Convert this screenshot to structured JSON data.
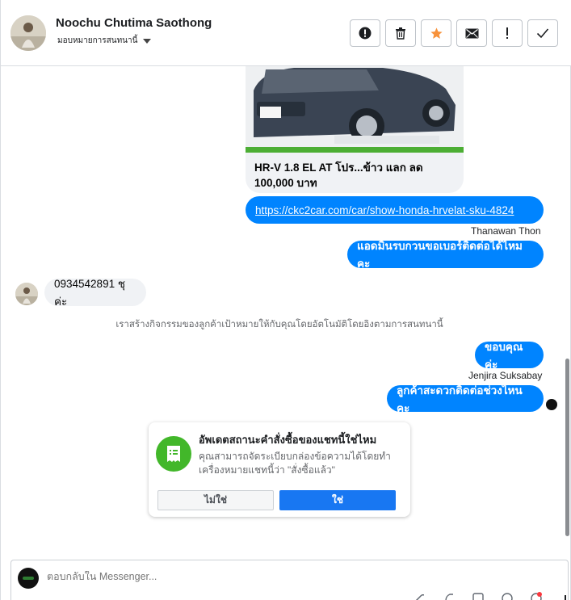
{
  "header": {
    "contact_name": "Noochu Chutima Saothong",
    "assign_label": "มอบหมายการสนทนานี้",
    "actions": [
      {
        "name": "spam-button",
        "icon": "alert-circle-icon"
      },
      {
        "name": "delete-button",
        "icon": "trash-icon"
      },
      {
        "name": "star-button",
        "icon": "star-icon"
      },
      {
        "name": "email-button",
        "icon": "envelope-icon"
      },
      {
        "name": "follow-up-button",
        "icon": "exclamation-icon"
      },
      {
        "name": "done-button",
        "icon": "check-icon"
      }
    ]
  },
  "messages": {
    "card_title": "HR-V 1.8 EL AT โปร...ข้าว แลก ลด 100,000 บาท",
    "link": "https://ckc2car.com/car/show-honda-hrvelat-sku-4824",
    "sender1": "Thanawan Thon",
    "out1": "แอดมินรบกวนขอเบอร์ติดต่อได้ไหมคะ",
    "in1": "0934542891 ชุค่ะ",
    "system_note": "เราสร้างกิจกรรมของลูกค้าเป้าหมายให้กับคุณโดยอัตโนมัติโดยอิงตามการสนทนานี้",
    "out2": "ขอบคุณค่ะ",
    "sender2": "Jenjira Suksabay",
    "out3": "ลูกค้าสะดวกติดต่อช่วงไหนคะ"
  },
  "prompt": {
    "title": "อัพเดตสถานะคำสั่งซื้อของแชทนี้ใช่ไหม",
    "body": "คุณสามารถจัดระเบียบกล่องข้อความได้โดยทำเครื่องหมายแชทนี้ว่า \"สั่งซื้อแล้ว\"",
    "no_label": "ไม่ใช่",
    "yes_label": "ใช่"
  },
  "composer": {
    "placeholder": "ตอบกลับใน Messenger..."
  },
  "colors": {
    "accent": "#0084ff",
    "button_blue": "#1877f2",
    "prompt_icon": "#42b72a",
    "star": "#f7923b"
  }
}
